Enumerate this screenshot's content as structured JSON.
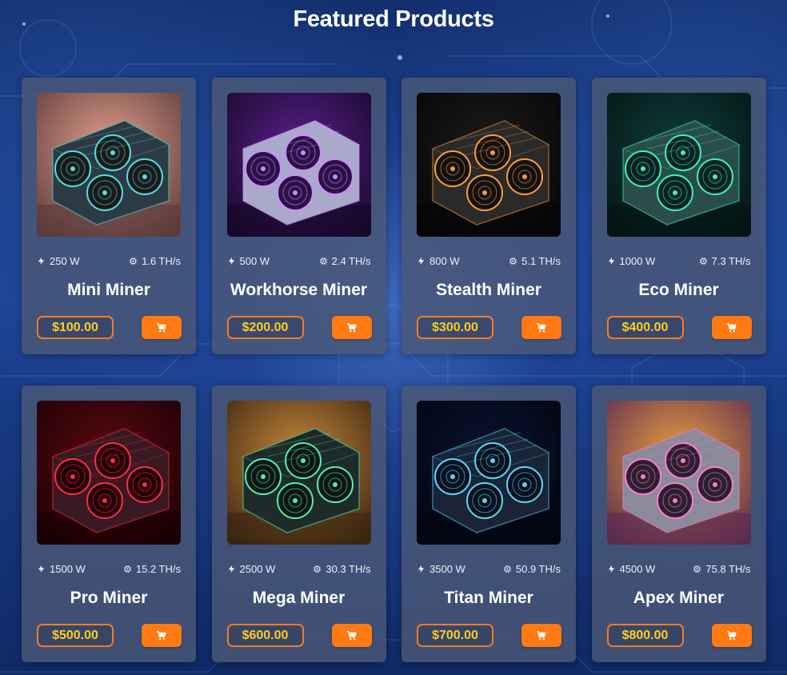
{
  "page": {
    "title": "Featured Products"
  },
  "colors": {
    "accent_orange": "#ff7a12",
    "price_text": "#ffcc1f",
    "card_bg": "#4a5876"
  },
  "icons": {
    "power": "lightning-bolt-icon",
    "hashrate": "chip-icon",
    "cart": "shopping-cart-icon"
  },
  "products": [
    {
      "name": "Mini Miner",
      "power": "250 W",
      "hashrate": "1.6 TH/s",
      "price": "$100.00"
    },
    {
      "name": "Workhorse Miner",
      "power": "500 W",
      "hashrate": "2.4 TH/s",
      "price": "$200.00"
    },
    {
      "name": "Stealth Miner",
      "power": "800 W",
      "hashrate": "5.1 TH/s",
      "price": "$300.00"
    },
    {
      "name": "Eco Miner",
      "power": "1000 W",
      "hashrate": "7.3 TH/s",
      "price": "$400.00"
    },
    {
      "name": "Pro Miner",
      "power": "1500 W",
      "hashrate": "15.2 TH/s",
      "price": "$500.00"
    },
    {
      "name": "Mega Miner",
      "power": "2500 W",
      "hashrate": "30.3 TH/s",
      "price": "$600.00"
    },
    {
      "name": "Titan Miner",
      "power": "3500 W",
      "hashrate": "50.9 TH/s",
      "price": "$700.00"
    },
    {
      "name": "Apex Miner",
      "power": "4500 W",
      "hashrate": "75.8 TH/s",
      "price": "$800.00"
    }
  ]
}
